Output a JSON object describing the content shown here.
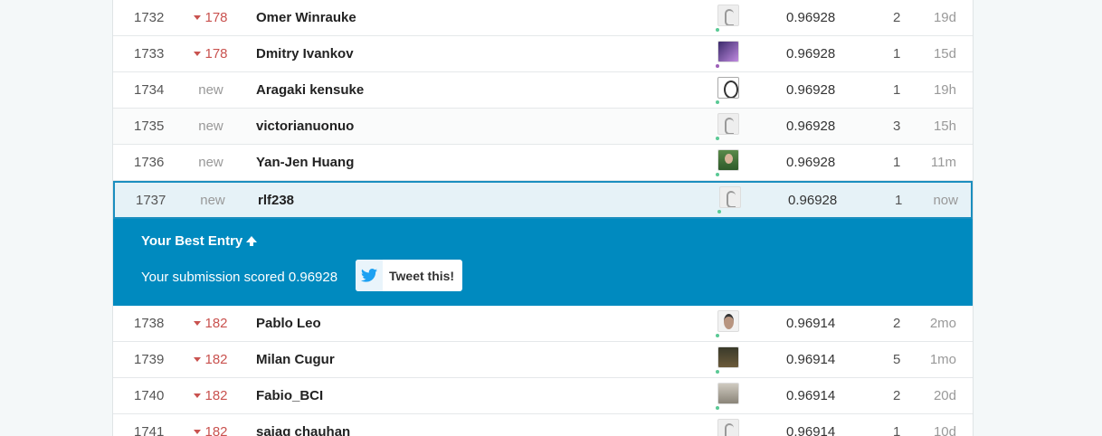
{
  "leaderboard": {
    "rows_before": [
      {
        "rank": "1732",
        "change": "178",
        "change_type": "down",
        "name": "Omer Winrauke",
        "avatar": "goose-avatar",
        "score": "0.96928",
        "entries": "2",
        "last": "19d"
      },
      {
        "rank": "1733",
        "change": "178",
        "change_type": "down",
        "name": "Dmitry Ivankov",
        "avatar": "purple-avatar",
        "score": "0.96928",
        "entries": "1",
        "last": "15d"
      },
      {
        "rank": "1734",
        "change": "new",
        "change_type": "new",
        "name": "Aragaki kensuke",
        "avatar": "sketch-avatar",
        "score": "0.96928",
        "entries": "1",
        "last": "19h"
      },
      {
        "rank": "1735",
        "change": "new",
        "change_type": "new",
        "name": "victorianuonuo",
        "avatar": "goose-avatar",
        "score": "0.96928",
        "entries": "3",
        "last": "15h"
      },
      {
        "rank": "1736",
        "change": "new",
        "change_type": "new",
        "name": "Yan-Jen Huang",
        "avatar": "photo-avatar",
        "score": "0.96928",
        "entries": "1",
        "last": "11m"
      }
    ],
    "my_row": {
      "rank": "1737",
      "change": "new",
      "name": "rlf238",
      "avatar": "goose-avatar",
      "score": "0.96928",
      "entries": "1",
      "last": "now"
    },
    "banner": {
      "best_label": "Your Best Entry",
      "scored_text": "Your submission scored 0.96928",
      "tweet_label": "Tweet this!"
    },
    "rows_after": [
      {
        "rank": "1738",
        "change": "182",
        "change_type": "down",
        "name": "Pablo Leo",
        "avatar": "photo-avatar",
        "score": "0.96914",
        "entries": "2",
        "last": "2mo"
      },
      {
        "rank": "1739",
        "change": "182",
        "change_type": "down",
        "name": "Milan Cugur",
        "avatar": "photo-avatar",
        "score": "0.96914",
        "entries": "5",
        "last": "1mo"
      },
      {
        "rank": "1740",
        "change": "182",
        "change_type": "down",
        "name": "Fabio_BCI",
        "avatar": "photo-avatar",
        "score": "0.96914",
        "entries": "2",
        "last": "20d"
      },
      {
        "rank": "1741",
        "change": "182",
        "change_type": "down",
        "name": "sajag chauhan",
        "avatar": "goose-avatar",
        "score": "0.96914",
        "entries": "1",
        "last": "10d"
      }
    ]
  },
  "colors": {
    "accent": "#008abf",
    "down": "#c9524f",
    "muted": "#999999"
  }
}
